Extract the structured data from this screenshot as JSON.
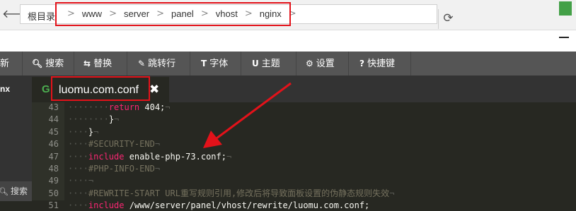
{
  "pathbar": {
    "root_label": "根目录",
    "crumbs": [
      "www",
      "server",
      "panel",
      "vhost",
      "nginx"
    ],
    "separator": ">"
  },
  "menu": {
    "items": [
      {
        "label": "新",
        "icon": ""
      },
      {
        "label": "搜索",
        "icon": "search-icon"
      },
      {
        "label": "替换",
        "icon": "replace-icon"
      },
      {
        "label": "跳转行",
        "icon": "pin-icon"
      },
      {
        "label": "字体",
        "icon": "font-icon"
      },
      {
        "label": "主题",
        "icon": "magnet-icon"
      },
      {
        "label": "设置",
        "icon": "gear-icon"
      },
      {
        "label": "快捷键",
        "icon": "help-icon"
      }
    ]
  },
  "sidebar": {
    "folder_label": "nx",
    "search_label": "搜索"
  },
  "tab": {
    "title": "luomu.com.conf"
  },
  "editor": {
    "line_numbers": [
      "43",
      "44",
      "45",
      "46",
      "47",
      "48",
      "49",
      "50",
      "51"
    ],
    "lines": [
      {
        "indent": "········",
        "kw": "return",
        "text": " 404;",
        "eol": "¬",
        "cm": ""
      },
      {
        "indent": "····",
        "kw": "",
        "text": "}",
        "eol": "¬",
        "cm": "",
        "pre": "····"
      },
      {
        "indent": "····",
        "kw": "",
        "text": "}",
        "eol": "¬",
        "cm": ""
      },
      {
        "indent": "····",
        "kw": "",
        "text": "",
        "eol": "¬",
        "cm": "#SECURITY-END"
      },
      {
        "indent": "····",
        "kw": "include",
        "text": " enable-php-73.conf;",
        "eol": "¬",
        "cm": ""
      },
      {
        "indent": "····",
        "kw": "",
        "text": "",
        "eol": "¬",
        "cm": "#PHP-INFO-END"
      },
      {
        "indent": "····",
        "kw": "",
        "text": "",
        "eol": "¬",
        "cm": ""
      },
      {
        "indent": "····",
        "kw": "",
        "text": "",
        "eol": "¬",
        "cm": "#REWRITE-START URL重写规则引用,修改后将导致面板设置的伪静态规则失效"
      },
      {
        "indent": "····",
        "kw": "include",
        "text": " /www/server/panel/vhost/rewrite/luomu.com.conf;",
        "eol": "",
        "cm": ""
      }
    ]
  },
  "colors": {
    "annotation_red": "#e3121a",
    "editor_bg": "#272822",
    "keyword": "#f92672",
    "comment": "#75715e"
  }
}
